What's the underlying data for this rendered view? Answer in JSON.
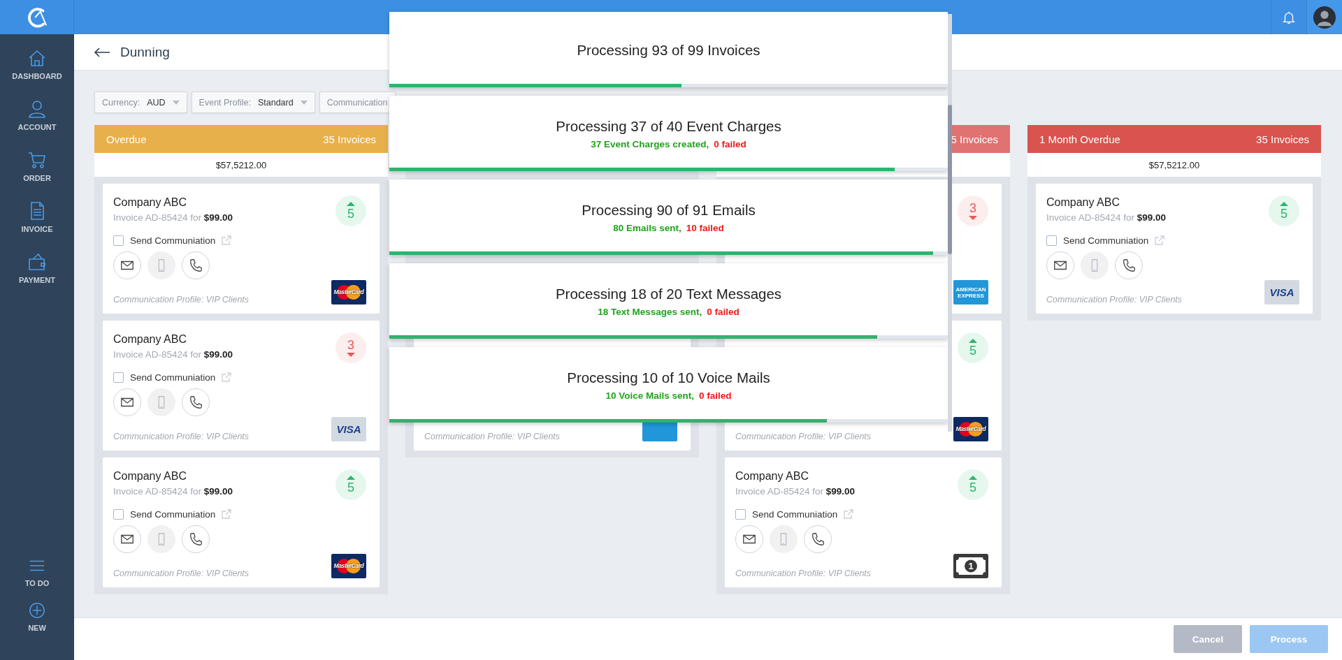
{
  "sidebar": {
    "items": [
      {
        "label": "DASHBOARD",
        "kind": "house",
        "selected": false
      },
      {
        "label": "ACCOUNT",
        "kind": "person",
        "selected": false
      },
      {
        "label": "ORDER",
        "kind": "cart",
        "selected": false
      },
      {
        "label": "INVOICE",
        "kind": "document",
        "selected": false
      },
      {
        "label": "PAYMENT",
        "kind": "wallet",
        "selected": false
      }
    ],
    "bottom_items": [
      {
        "label": "TO DO",
        "kind": "menu"
      },
      {
        "label": "NEW",
        "kind": "plus"
      }
    ]
  },
  "page": {
    "title": "Dunning"
  },
  "filters": [
    {
      "label": "Currency:",
      "value": "AUD"
    },
    {
      "label": "Event Profile:",
      "value": "Standard"
    },
    {
      "label": "Communication"
    }
  ],
  "columns": [
    {
      "kind": "open",
      "title": "Overdue",
      "count": "35 Invoices",
      "color": "#e8b04a",
      "total": "$57,5212.00",
      "cards": [
        {
          "company": "Company ABC",
          "invoice": "Invoice AD-85424 for **$99.00**",
          "checkbox": {
            "label": "Send Communiation",
            "checked": false
          },
          "channels": [
            {
              "kind": "email",
              "disabled": false
            },
            {
              "kind": "mobile",
              "disabled": true
            },
            {
              "kind": "phone",
              "disabled": false
            }
          ],
          "profile": "Communication Profile: VIP Clients",
          "badge": {
            "value": "5",
            "kind": "up"
          },
          "payment": {
            "kind": "mastercard",
            "label": "MasterCard"
          }
        },
        {
          "company": "Company ABC",
          "invoice": "Invoice AD-85424 for **$99.00**",
          "checkbox": {
            "label": "Send Communiation",
            "checked": false
          },
          "channels": [
            {
              "kind": "email",
              "disabled": false
            },
            {
              "kind": "mobile",
              "disabled": true
            },
            {
              "kind": "phone",
              "disabled": false
            }
          ],
          "profile": "Communication Profile: VIP Clients",
          "badge": {
            "value": "3",
            "kind": "down"
          },
          "payment": {
            "kind": "visa",
            "label": "VISA"
          }
        },
        {
          "company": "Company ABC",
          "invoice": "Invoice AD-85424 for **$99.00**",
          "checkbox": {
            "label": "Send Communiation",
            "checked": false
          },
          "channels": [
            {
              "kind": "email",
              "disabled": false
            },
            {
              "kind": "mobile",
              "disabled": true
            },
            {
              "kind": "phone",
              "disabled": false
            }
          ],
          "profile": "Communication Profile: VIP Clients",
          "badge": {
            "value": "5",
            "kind": "up"
          },
          "payment": {
            "kind": "mastercard",
            "label": "MasterCard"
          }
        }
      ]
    },
    {
      "kind": "covered",
      "cards": [
        {
          "profile": "Communication Profile: VIP Clients",
          "payment": {
            "kind": "amex"
          }
        }
      ]
    },
    {
      "kind": "open",
      "count": "5 Invoices",
      "color": "#e07272",
      "cards": [
        {
          "badge": {
            "value": "3",
            "kind": "down"
          },
          "payment": {
            "kind": "amex",
            "label": "AMERICAN EXPRESS"
          }
        },
        {
          "profile": "Communication Profile: VIP Clients",
          "badge": {
            "value": "5",
            "kind": "up"
          },
          "payment": {
            "kind": "mastercard",
            "label": "MasterCard"
          }
        },
        {
          "company": "Company ABC",
          "invoice": "Invoice AD-85424 for **$99.00**",
          "checkbox": {
            "label": "Send Communiation",
            "checked": false
          },
          "channels": [
            {
              "kind": "email",
              "disabled": false
            },
            {
              "kind": "mobile",
              "disabled": true
            },
            {
              "kind": "phone",
              "disabled": false
            }
          ],
          "profile": "Communication Profile: VIP Clients",
          "badge": {
            "value": "5",
            "kind": "up"
          },
          "payment": {
            "kind": "cash",
            "label": "1"
          }
        }
      ]
    },
    {
      "kind": "open",
      "title": "1 Month Overdue",
      "count": "35 Invoices",
      "color": "#d9534f",
      "total": "$57,5212.00",
      "cards": [
        {
          "company": "Company ABC",
          "invoice": "Invoice AD-85424 for **$99.00**",
          "checkbox": {
            "label": "Send Communiation",
            "checked": false
          },
          "channels": [
            {
              "kind": "email",
              "disabled": false
            },
            {
              "kind": "mobile",
              "disabled": true
            },
            {
              "kind": "phone",
              "disabled": false
            }
          ],
          "profile": "Communication Profile: VIP Clients",
          "badge": {
            "value": "5",
            "kind": "up"
          },
          "payment": {
            "kind": "visa",
            "label": "VISA"
          }
        }
      ]
    }
  ],
  "progress": [
    {
      "title": "Processing 93 of 99 Invoices",
      "level": 0.523
    },
    {
      "title": "Processing 37 of 40 Event Charges",
      "done": "37 Event Charges created,",
      "failed": "0 failed",
      "level": 0.905
    },
    {
      "title": "Processing 90 of 91 Emails",
      "done": "80 Emails sent,",
      "failed": "10 failed",
      "level": 0.974
    },
    {
      "title": "Processing 18 of 20 Text Messages",
      "done": "18 Text Messages sent,",
      "failed": "0 failed",
      "level": 0.874
    },
    {
      "title": "Processing 10 of 10 Voice Mails",
      "done": "10 Voice Mails sent,",
      "failed": "0 failed",
      "level": 0.783
    }
  ],
  "footer": {
    "buttons": [
      {
        "label": "Cancel",
        "kind": "cancel",
        "disabled": true
      },
      {
        "label": "Process",
        "kind": "primary",
        "disabled": true
      }
    ]
  }
}
